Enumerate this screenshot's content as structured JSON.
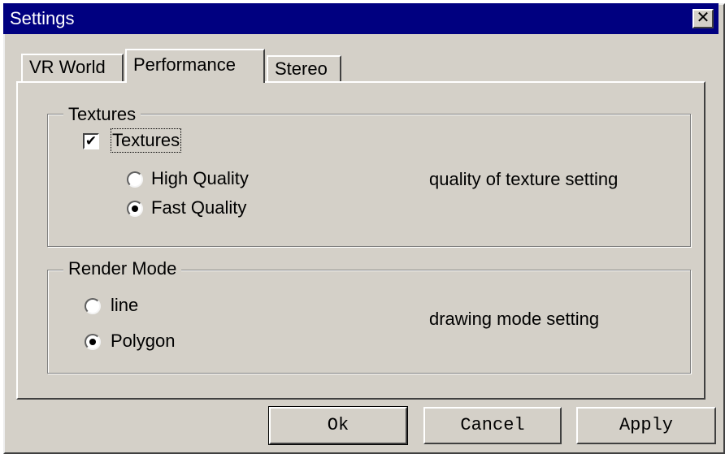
{
  "window": {
    "title": "Settings",
    "close_symbol": "✕"
  },
  "tabs": [
    {
      "label": "VR World",
      "active": false
    },
    {
      "label": "Performance",
      "active": true
    },
    {
      "label": "Stereo",
      "active": false
    }
  ],
  "textures_group": {
    "title": "Textures",
    "checkbox_label": "Textures",
    "checked": true,
    "check_mark": "✔",
    "options": [
      {
        "label": "High Quality",
        "selected": false
      },
      {
        "label": "Fast Quality",
        "selected": true
      }
    ],
    "description": "quality of texture setting"
  },
  "render_group": {
    "title": "Render Mode",
    "options": [
      {
        "label": "line",
        "selected": false
      },
      {
        "label": "Polygon",
        "selected": true
      }
    ],
    "description": "drawing mode setting"
  },
  "buttons": {
    "ok": "Ok",
    "cancel": "Cancel",
    "apply": "Apply"
  },
  "colors": {
    "title_bar": "#000080",
    "face": "#d4d0c8"
  }
}
